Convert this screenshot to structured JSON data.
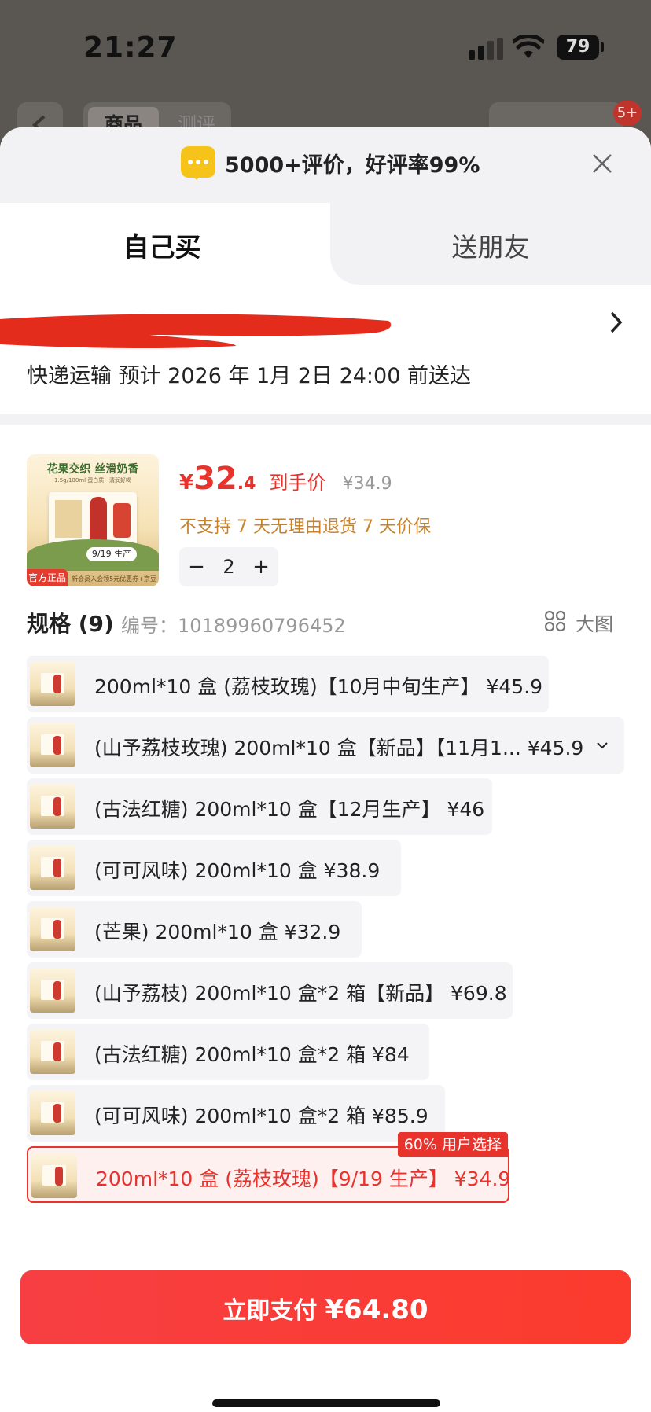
{
  "status": {
    "time": "21:27",
    "battery": "79"
  },
  "background_tabs": {
    "product": "商品",
    "review": "测评",
    "badge": "5+"
  },
  "header": {
    "rating_text": "5000+评价，好评率99%"
  },
  "tabs": {
    "self": "自己买",
    "gift": "送朋友"
  },
  "delivery": {
    "text": "快递运输 预计 2026 年 1月 2日 24:00 前送达"
  },
  "product": {
    "image": {
      "title": "花果交织 丝滑奶香",
      "subtitle": "1.5g/100ml 蛋白质 · 清润好喝",
      "date_tag": "9/19 生产",
      "official": "官方正品",
      "promo": "新会员入会领5元优惠券+京豆*20"
    },
    "price_symbol": "¥",
    "price_integer": "32",
    "price_decimal": ".4",
    "price_label": "到手价",
    "original_price": "¥34.9",
    "policy": "不支持 7 天无理由退货   7 天价保",
    "quantity": "2",
    "minus_label": "−",
    "plus_label": "+"
  },
  "specs": {
    "title": "规格 (9)",
    "code": "编号：10189960796452",
    "big_view_label": "大图",
    "items": [
      {
        "label": "200ml*10 盒 (荔枝玫瑰)【10月中旬生产】 ¥45.9"
      },
      {
        "label": "(山予荔枝玫瑰) 200ml*10 盒【新品】【11月1...   ¥45.9"
      },
      {
        "label": "(古法红糖) 200ml*10 盒【12月生产】 ¥46"
      },
      {
        "label": "(可可风味) 200ml*10 盒   ¥38.9"
      },
      {
        "label": "(芒果) 200ml*10 盒   ¥32.9"
      },
      {
        "label": "(山予荔枝) 200ml*10 盒*2 箱【新品】 ¥69.8"
      },
      {
        "label": "(古法红糖) 200ml*10 盒*2 箱   ¥84"
      },
      {
        "label": "(可可风味) 200ml*10 盒*2 箱   ¥85.9"
      },
      {
        "label": "200ml*10 盒 (荔枝玫瑰)【9/19 生产】 ¥34.9",
        "badge": "60% 用户选择"
      }
    ]
  },
  "pay": {
    "label": "立即支付",
    "amount": "¥64.80"
  },
  "colors": {
    "accent": "#e8332d",
    "pay_button": "#f73e42",
    "policy": "#c7832c"
  }
}
